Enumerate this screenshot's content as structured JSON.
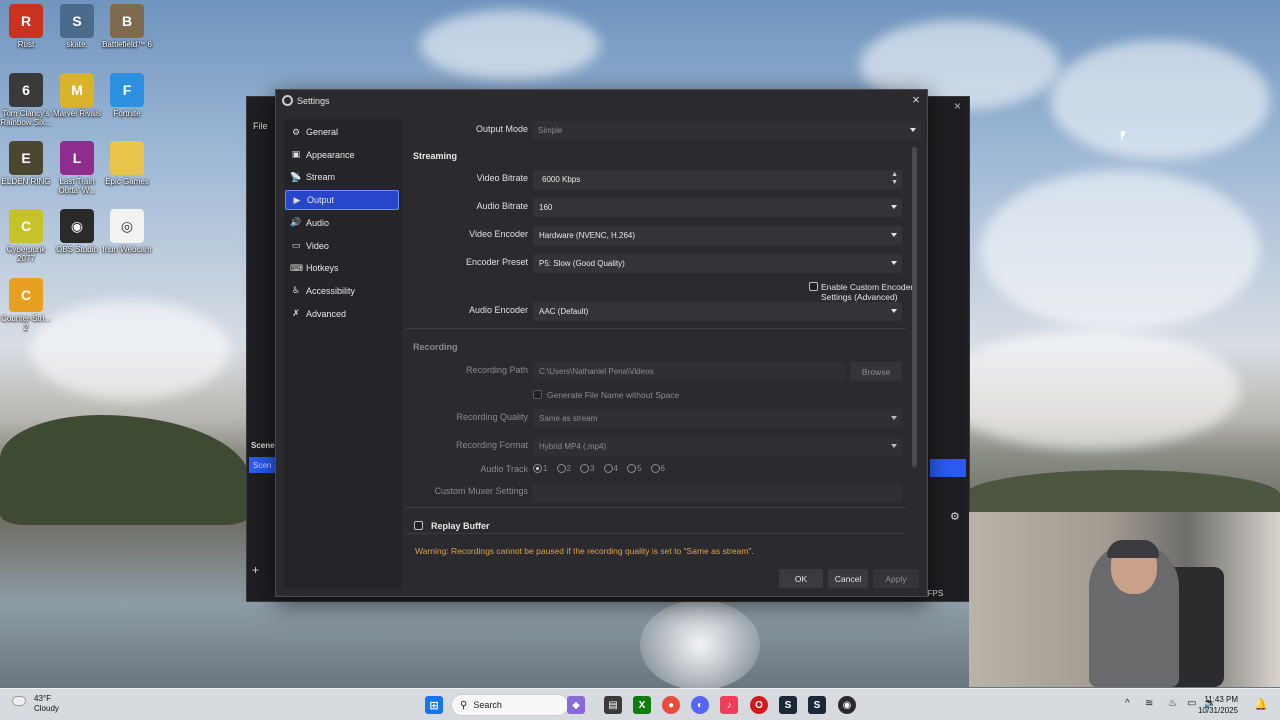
{
  "desktop": {
    "icons": [
      {
        "label": "Rust",
        "color": "#c8321e",
        "glyph": "R"
      },
      {
        "label": "skate.",
        "color": "#4b6b8c",
        "glyph": "S"
      },
      {
        "label": "Battlefield™ 6",
        "color": "#7d6a4f",
        "glyph": "B"
      },
      {
        "label": "Tom Clancy's Rainbow Six...",
        "color": "#3a3a3a",
        "glyph": "6"
      },
      {
        "label": "Marvel Rivals",
        "color": "#d9b32c",
        "glyph": "M"
      },
      {
        "label": "Fortnite",
        "color": "#2d8fe0",
        "glyph": "F"
      },
      {
        "label": "ELDEN RING",
        "color": "#4a4630",
        "glyph": "E"
      },
      {
        "label": "Last Train Outta' W...",
        "color": "#8e2d8e",
        "glyph": "L"
      },
      {
        "label": "Epic Games",
        "color": "#e9c44a",
        "glyph": ""
      },
      {
        "label": "Cyberpunk 2077",
        "color": "#c6c22a",
        "glyph": "C"
      },
      {
        "label": "OBS Studio",
        "color": "#2a2a2a",
        "glyph": "◉"
      },
      {
        "label": "Iriun Webcam",
        "color": "#f2f2f2",
        "glyph": "◎"
      },
      {
        "label": "Counter-Stri... 2",
        "color": "#e8a020",
        "glyph": "C"
      }
    ]
  },
  "obs_main": {
    "menu_file": "File",
    "scenes_header": "Scene",
    "scene_item": "Scen",
    "fps_text": "0 FPS"
  },
  "settings": {
    "title": "Settings",
    "nav": [
      {
        "label": "General",
        "icon": "gear-icon",
        "glyph": "⚙",
        "active": false
      },
      {
        "label": "Appearance",
        "icon": "appearance-icon",
        "glyph": "▣",
        "active": false
      },
      {
        "label": "Stream",
        "icon": "stream-icon",
        "glyph": "📡",
        "active": false
      },
      {
        "label": "Output",
        "icon": "output-icon",
        "glyph": "▶",
        "active": true
      },
      {
        "label": "Audio",
        "icon": "speaker-icon",
        "glyph": "🔊",
        "active": false
      },
      {
        "label": "Video",
        "icon": "monitor-icon",
        "glyph": "▭",
        "active": false
      },
      {
        "label": "Hotkeys",
        "icon": "keyboard-icon",
        "glyph": "⌨",
        "active": false
      },
      {
        "label": "Accessibility",
        "icon": "accessibility-icon",
        "glyph": "♿",
        "active": false
      },
      {
        "label": "Advanced",
        "icon": "wrench-icon",
        "glyph": "✗",
        "active": false
      }
    ],
    "output_mode": {
      "label": "Output Mode",
      "value": "Simple"
    },
    "streaming": {
      "header": "Streaming",
      "video_bitrate": {
        "label": "Video Bitrate",
        "value": "6000 Kbps"
      },
      "audio_bitrate": {
        "label": "Audio Bitrate",
        "value": "160"
      },
      "video_encoder": {
        "label": "Video Encoder",
        "value": "Hardware (NVENC, H.264)"
      },
      "encoder_preset": {
        "label": "Encoder Preset",
        "value": "P5: Slow (Good Quality)"
      },
      "custom_encoder_checkbox": "Enable Custom Encoder Settings (Advanced)",
      "audio_encoder": {
        "label": "Audio Encoder",
        "value": "AAC (Default)"
      }
    },
    "recording": {
      "header": "Recording",
      "path": {
        "label": "Recording Path",
        "value": "C:\\Users\\Nathaniel Pena\\Videos"
      },
      "browse": "Browse",
      "no_space_checkbox": "Generate File Name without Space",
      "quality": {
        "label": "Recording Quality",
        "value": "Same as stream"
      },
      "format": {
        "label": "Recording Format",
        "value": "Hybrid MP4 (.mp4)"
      },
      "audio_track": {
        "label": "Audio Track",
        "tracks": [
          "1",
          "2",
          "3",
          "4",
          "5",
          "6"
        ],
        "selected": "1"
      },
      "muxer": {
        "label": "Custom Muxer Settings",
        "value": ""
      }
    },
    "replay_buffer": "Replay Buffer",
    "warning": "Warning: Recordings cannot be paused if the recording quality is set to \"Same as stream\".",
    "buttons": {
      "ok": "OK",
      "cancel": "Cancel",
      "apply": "Apply"
    }
  },
  "taskbar": {
    "weather_temp": "43°F",
    "weather_cond": "Cloudy",
    "search_placeholder": "Search",
    "time": "11:43 PM",
    "date": "10/31/2025"
  }
}
